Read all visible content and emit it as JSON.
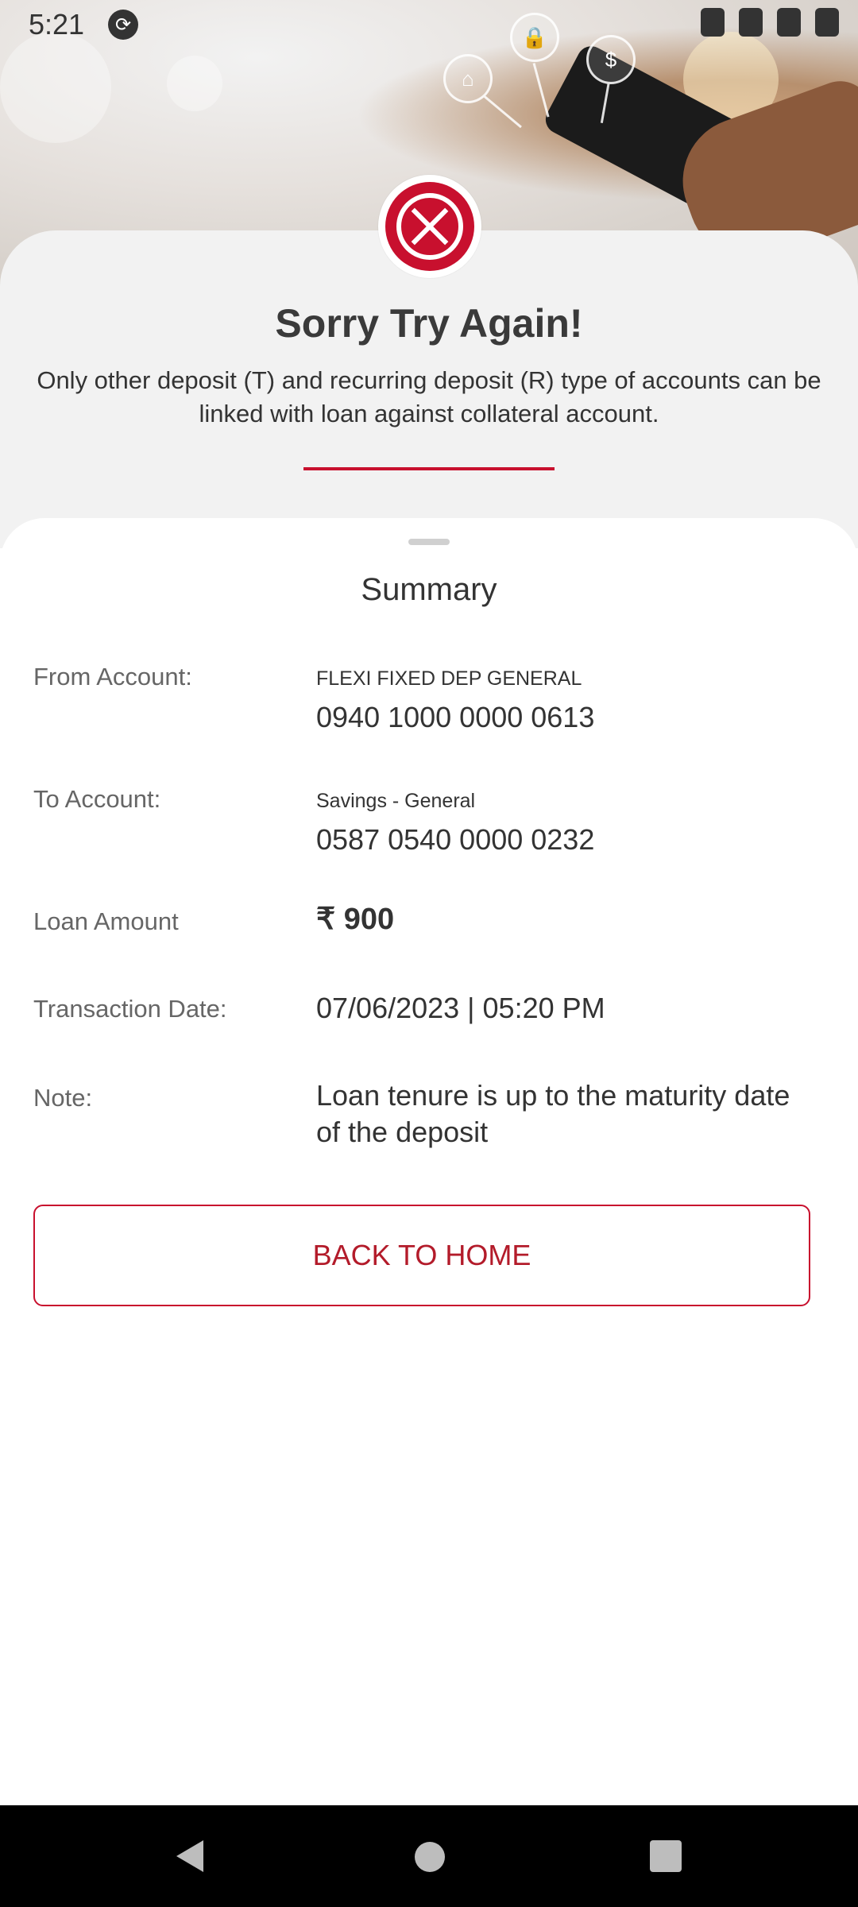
{
  "status_bar": {
    "time": "5:21"
  },
  "error": {
    "title": "Sorry Try Again!",
    "message": "Only other deposit (T) and recurring deposit (R) type of accounts can be linked with loan against collateral account."
  },
  "summary": {
    "title": "Summary",
    "from_account": {
      "label": "From Account:",
      "name": "FLEXI FIXED DEP GENERAL",
      "number": "0940 1000 0000 0613"
    },
    "to_account": {
      "label": "To Account:",
      "name": "Savings - General",
      "number": "0587 0540 0000 0232"
    },
    "loan_amount": {
      "label": "Loan Amount",
      "value": "₹ 900"
    },
    "transaction_date": {
      "label": "Transaction Date:",
      "value": "07/06/2023 | 05:20 PM"
    },
    "note": {
      "label": "Note:",
      "value": "Loan tenure is up to the maturity date of the deposit"
    }
  },
  "actions": {
    "back_home": "BACK TO HOME"
  },
  "colors": {
    "accent": "#c8102e",
    "sheet_bg": "#f2f2f2"
  },
  "icons": [
    "sync-icon",
    "location-icon",
    "wifi-icon",
    "signal-icon",
    "battery-icon",
    "error-x-icon",
    "back-nav-icon",
    "home-nav-icon",
    "recents-nav-icon"
  ]
}
